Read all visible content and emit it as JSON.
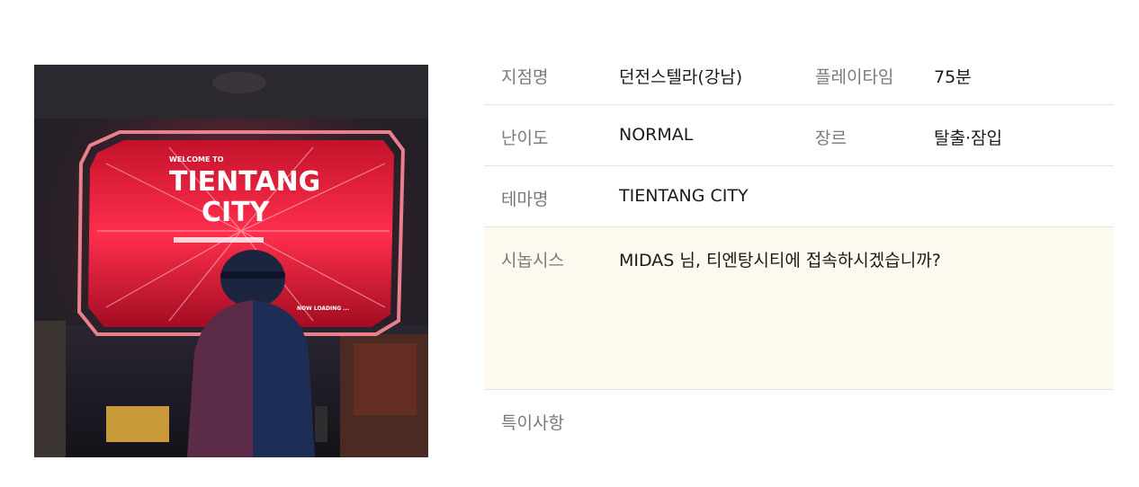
{
  "poster": {
    "welcome_text": "WELCOME TO",
    "title_line1": "TIENTANG",
    "title_line2": "CITY",
    "loading_text": "NOW LOADING ...",
    "accent_color": "#e8243c",
    "glow_color": "#ff5a6e"
  },
  "details": {
    "branch_label": "지점명",
    "branch_value": "던전스텔라(강남)",
    "playtime_label": "플레이타임",
    "playtime_value": "75분",
    "difficulty_label": "난이도",
    "difficulty_value": "NORMAL",
    "genre_label": "장르",
    "genre_value": "탈출·잠입",
    "theme_label": "테마명",
    "theme_value": "TIENTANG CITY",
    "synopsis_label": "시놉시스",
    "synopsis_value": "MIDAS 님, 티엔탕시티에 접속하시겠습니까?",
    "notes_label": "특이사항",
    "notes_value": ""
  }
}
